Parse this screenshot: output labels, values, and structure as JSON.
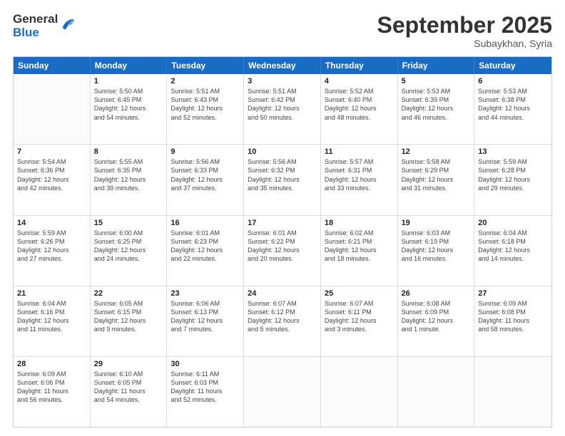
{
  "logo": {
    "general": "General",
    "blue": "Blue"
  },
  "header": {
    "month": "September 2025",
    "location": "Subaykhan, Syria"
  },
  "weekdays": [
    "Sunday",
    "Monday",
    "Tuesday",
    "Wednesday",
    "Thursday",
    "Friday",
    "Saturday"
  ],
  "rows": [
    [
      {
        "day": "",
        "lines": []
      },
      {
        "day": "1",
        "lines": [
          "Sunrise: 5:50 AM",
          "Sunset: 6:45 PM",
          "Daylight: 12 hours",
          "and 54 minutes."
        ]
      },
      {
        "day": "2",
        "lines": [
          "Sunrise: 5:51 AM",
          "Sunset: 6:43 PM",
          "Daylight: 12 hours",
          "and 52 minutes."
        ]
      },
      {
        "day": "3",
        "lines": [
          "Sunrise: 5:51 AM",
          "Sunset: 6:42 PM",
          "Daylight: 12 hours",
          "and 50 minutes."
        ]
      },
      {
        "day": "4",
        "lines": [
          "Sunrise: 5:52 AM",
          "Sunset: 6:40 PM",
          "Daylight: 12 hours",
          "and 48 minutes."
        ]
      },
      {
        "day": "5",
        "lines": [
          "Sunrise: 5:53 AM",
          "Sunset: 6:39 PM",
          "Daylight: 12 hours",
          "and 46 minutes."
        ]
      },
      {
        "day": "6",
        "lines": [
          "Sunrise: 5:53 AM",
          "Sunset: 6:38 PM",
          "Daylight: 12 hours",
          "and 44 minutes."
        ]
      }
    ],
    [
      {
        "day": "7",
        "lines": [
          "Sunrise: 5:54 AM",
          "Sunset: 6:36 PM",
          "Daylight: 12 hours",
          "and 42 minutes."
        ]
      },
      {
        "day": "8",
        "lines": [
          "Sunrise: 5:55 AM",
          "Sunset: 6:35 PM",
          "Daylight: 12 hours",
          "and 39 minutes."
        ]
      },
      {
        "day": "9",
        "lines": [
          "Sunrise: 5:56 AM",
          "Sunset: 6:33 PM",
          "Daylight: 12 hours",
          "and 37 minutes."
        ]
      },
      {
        "day": "10",
        "lines": [
          "Sunrise: 5:56 AM",
          "Sunset: 6:32 PM",
          "Daylight: 12 hours",
          "and 35 minutes."
        ]
      },
      {
        "day": "11",
        "lines": [
          "Sunrise: 5:57 AM",
          "Sunset: 6:31 PM",
          "Daylight: 12 hours",
          "and 33 minutes."
        ]
      },
      {
        "day": "12",
        "lines": [
          "Sunrise: 5:58 AM",
          "Sunset: 6:29 PM",
          "Daylight: 12 hours",
          "and 31 minutes."
        ]
      },
      {
        "day": "13",
        "lines": [
          "Sunrise: 5:59 AM",
          "Sunset: 6:28 PM",
          "Daylight: 12 hours",
          "and 29 minutes."
        ]
      }
    ],
    [
      {
        "day": "14",
        "lines": [
          "Sunrise: 5:59 AM",
          "Sunset: 6:26 PM",
          "Daylight: 12 hours",
          "and 27 minutes."
        ]
      },
      {
        "day": "15",
        "lines": [
          "Sunrise: 6:00 AM",
          "Sunset: 6:25 PM",
          "Daylight: 12 hours",
          "and 24 minutes."
        ]
      },
      {
        "day": "16",
        "lines": [
          "Sunrise: 6:01 AM",
          "Sunset: 6:23 PM",
          "Daylight: 12 hours",
          "and 22 minutes."
        ]
      },
      {
        "day": "17",
        "lines": [
          "Sunrise: 6:01 AM",
          "Sunset: 6:22 PM",
          "Daylight: 12 hours",
          "and 20 minutes."
        ]
      },
      {
        "day": "18",
        "lines": [
          "Sunrise: 6:02 AM",
          "Sunset: 6:21 PM",
          "Daylight: 12 hours",
          "and 18 minutes."
        ]
      },
      {
        "day": "19",
        "lines": [
          "Sunrise: 6:03 AM",
          "Sunset: 6:19 PM",
          "Daylight: 12 hours",
          "and 16 minutes."
        ]
      },
      {
        "day": "20",
        "lines": [
          "Sunrise: 6:04 AM",
          "Sunset: 6:18 PM",
          "Daylight: 12 hours",
          "and 14 minutes."
        ]
      }
    ],
    [
      {
        "day": "21",
        "lines": [
          "Sunrise: 6:04 AM",
          "Sunset: 6:16 PM",
          "Daylight: 12 hours",
          "and 11 minutes."
        ]
      },
      {
        "day": "22",
        "lines": [
          "Sunrise: 6:05 AM",
          "Sunset: 6:15 PM",
          "Daylight: 12 hours",
          "and 9 minutes."
        ]
      },
      {
        "day": "23",
        "lines": [
          "Sunrise: 6:06 AM",
          "Sunset: 6:13 PM",
          "Daylight: 12 hours",
          "and 7 minutes."
        ]
      },
      {
        "day": "24",
        "lines": [
          "Sunrise: 6:07 AM",
          "Sunset: 6:12 PM",
          "Daylight: 12 hours",
          "and 5 minutes."
        ]
      },
      {
        "day": "25",
        "lines": [
          "Sunrise: 6:07 AM",
          "Sunset: 6:11 PM",
          "Daylight: 12 hours",
          "and 3 minutes."
        ]
      },
      {
        "day": "26",
        "lines": [
          "Sunrise: 6:08 AM",
          "Sunset: 6:09 PM",
          "Daylight: 12 hours",
          "and 1 minute."
        ]
      },
      {
        "day": "27",
        "lines": [
          "Sunrise: 6:09 AM",
          "Sunset: 6:08 PM",
          "Daylight: 11 hours",
          "and 58 minutes."
        ]
      }
    ],
    [
      {
        "day": "28",
        "lines": [
          "Sunrise: 6:09 AM",
          "Sunset: 6:06 PM",
          "Daylight: 11 hours",
          "and 56 minutes."
        ]
      },
      {
        "day": "29",
        "lines": [
          "Sunrise: 6:10 AM",
          "Sunset: 6:05 PM",
          "Daylight: 11 hours",
          "and 54 minutes."
        ]
      },
      {
        "day": "30",
        "lines": [
          "Sunrise: 6:11 AM",
          "Sunset: 6:03 PM",
          "Daylight: 11 hours",
          "and 52 minutes."
        ]
      },
      {
        "day": "",
        "lines": []
      },
      {
        "day": "",
        "lines": []
      },
      {
        "day": "",
        "lines": []
      },
      {
        "day": "",
        "lines": []
      }
    ]
  ]
}
